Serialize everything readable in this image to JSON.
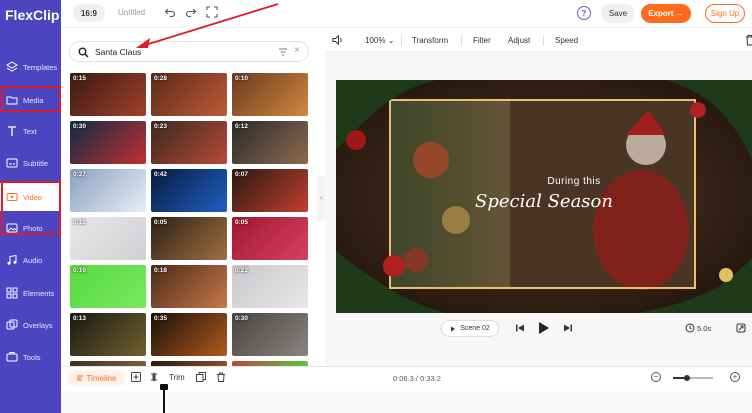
{
  "app": {
    "logo_text": "FlexClip"
  },
  "sidebar": {
    "items": [
      {
        "label": "Templates",
        "icon": "layers-icon"
      },
      {
        "label": "Media",
        "icon": "folder-icon"
      },
      {
        "label": "Text",
        "icon": "text-icon"
      },
      {
        "label": "Subtitle",
        "icon": "subtitle-icon"
      },
      {
        "label": "Video",
        "icon": "video-icon"
      },
      {
        "label": "Photo",
        "icon": "photo-icon"
      },
      {
        "label": "Audio",
        "icon": "music-icon"
      },
      {
        "label": "Elements",
        "icon": "elements-icon"
      },
      {
        "label": "Overlays",
        "icon": "overlays-icon"
      },
      {
        "label": "Tools",
        "icon": "tools-icon"
      }
    ],
    "active": "Video"
  },
  "topbar": {
    "ratio": "16:9",
    "title": "Untitled",
    "help": "?",
    "save_label": "Save",
    "export_label": "Export →",
    "signup_label": "Sign Up"
  },
  "search": {
    "value": "Santa Claus"
  },
  "media": {
    "thumbs": [
      {
        "duration": "0:15",
        "c1": "#3a1a12",
        "c2": "#a0412a"
      },
      {
        "duration": "0:28",
        "c1": "#5a2a1a",
        "c2": "#c05a38"
      },
      {
        "duration": "0:10",
        "c1": "#6a3a20",
        "c2": "#d08840"
      },
      {
        "duration": "0:30",
        "c1": "#102a45",
        "c2": "#c03030"
      },
      {
        "duration": "0:23",
        "c1": "#3a2a20",
        "c2": "#b8483a"
      },
      {
        "duration": "0:12",
        "c1": "#2a2a2a",
        "c2": "#8a6a50"
      },
      {
        "duration": "0:27",
        "c1": "#8aa0c0",
        "c2": "#e8eef5"
      },
      {
        "duration": "0:42",
        "c1": "#081a40",
        "c2": "#2060c0"
      },
      {
        "duration": "0:07",
        "c1": "#2a1a10",
        "c2": "#c04030"
      },
      {
        "duration": "0:11",
        "c1": "#e8e8ea",
        "c2": "#d0d0d4"
      },
      {
        "duration": "0:05",
        "c1": "#2a2018",
        "c2": "#a07040"
      },
      {
        "duration": "0:05",
        "c1": "#a01830",
        "c2": "#d84060"
      },
      {
        "duration": "0:10",
        "c1": "#58d840",
        "c2": "#78e860"
      },
      {
        "duration": "0:18",
        "c1": "#4a2a18",
        "c2": "#c8784a"
      },
      {
        "duration": "0:22",
        "c1": "#c8c8cc",
        "c2": "#e8e8ea"
      },
      {
        "duration": "0:13",
        "c1": "#1a1a12",
        "c2": "#706030"
      },
      {
        "duration": "0:35",
        "c1": "#1a1008",
        "c2": "#b05a20"
      },
      {
        "duration": "0:30",
        "c1": "#4a4440",
        "c2": "#8a8480"
      },
      {
        "duration": "",
        "c1": "#3a3020",
        "c2": "#806040"
      },
      {
        "duration": "",
        "c1": "#2a1810",
        "c2": "#905030"
      },
      {
        "duration": "",
        "c1": "#c04040",
        "c2": "#50d040"
      }
    ]
  },
  "edit_toolbar": {
    "volume_icon": "speaker-icon",
    "zoom": "100%",
    "items": [
      "Transform",
      "Filter",
      "Adjust",
      "Speed"
    ]
  },
  "canvas": {
    "line1": "During this",
    "line2": "Special Season"
  },
  "player": {
    "scene_label": "Scene 02",
    "duration": "5.0s"
  },
  "timeline": {
    "tab_label": "Timeline",
    "trim_label": "Trim",
    "timecode": "0:06.3 / 0:33.2",
    "zoom_level": 0.35
  },
  "colors": {
    "accent": "#ff6b1a",
    "sidebar": "#4b45c2",
    "annotation": "#e01b24"
  }
}
